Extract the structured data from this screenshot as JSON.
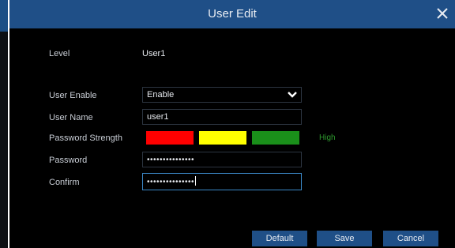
{
  "dialog": {
    "title": "User Edit"
  },
  "form": {
    "level_label": "Level",
    "level_value": "User1",
    "user_enable_label": "User Enable",
    "user_enable_value": "Enable",
    "user_name_label": "User Name",
    "user_name_value": "user1",
    "password_strength_label": "Password Strength",
    "password_strength_colors": [
      "#ff0000",
      "#ffff00",
      "#1a8f1a"
    ],
    "password_strength_value": "High",
    "password_label": "Password",
    "password_value": "•••••••••••••••",
    "confirm_label": "Confirm",
    "confirm_value": "•••••••••••••••"
  },
  "buttons": {
    "default_label": "Default",
    "save_label": "Save",
    "cancel_label": "Cancel"
  },
  "icons": {
    "close": "close-icon",
    "dropdown": "chevron-down-icon"
  }
}
